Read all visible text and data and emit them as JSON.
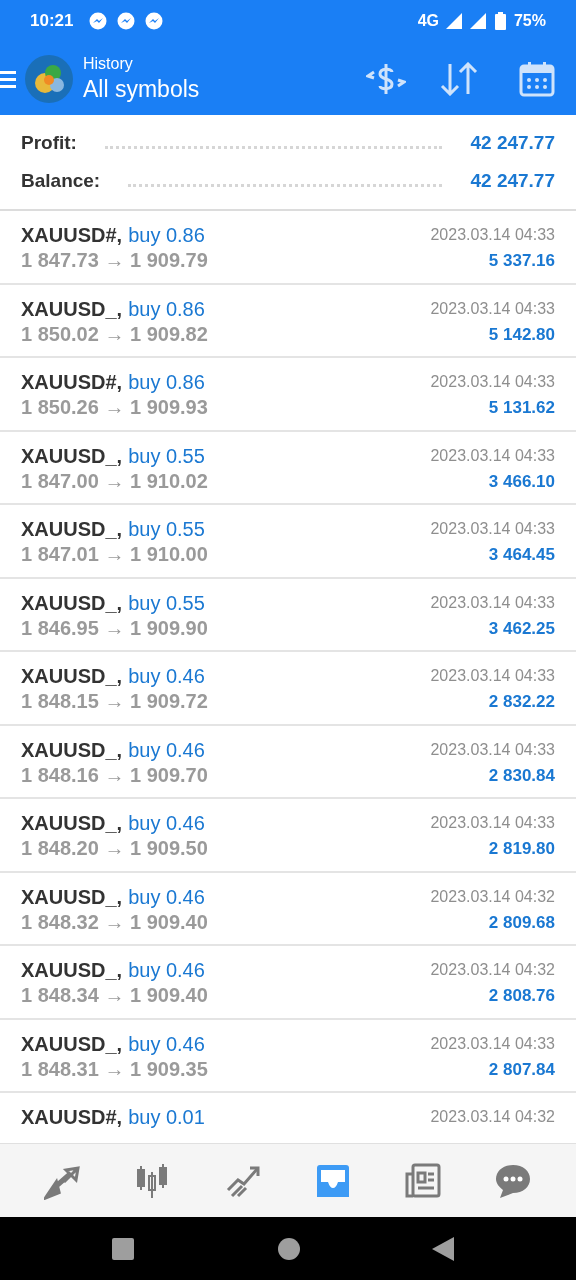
{
  "status_bar": {
    "time": "10:21",
    "network": "4G",
    "battery": "75%"
  },
  "header": {
    "subtitle": "History",
    "title": "All symbols"
  },
  "summary": [
    {
      "label": "Profit:",
      "value": "42 247.77"
    },
    {
      "label": "Balance:",
      "value": "42 247.77"
    }
  ],
  "deals": [
    {
      "symbol": "XAUUSD#,",
      "action": "buy 0.86",
      "prices": "1 847.73 → 1 909.79",
      "time": "2023.03.14 04:33",
      "profit": "5 337.16"
    },
    {
      "symbol": "XAUUSD_,",
      "action": "buy 0.86",
      "prices": "1 850.02 → 1 909.82",
      "time": "2023.03.14 04:33",
      "profit": "5 142.80"
    },
    {
      "symbol": "XAUUSD#,",
      "action": "buy 0.86",
      "prices": "1 850.26 → 1 909.93",
      "time": "2023.03.14 04:33",
      "profit": "5 131.62"
    },
    {
      "symbol": "XAUUSD_,",
      "action": "buy 0.55",
      "prices": "1 847.00 → 1 910.02",
      "time": "2023.03.14 04:33",
      "profit": "3 466.10"
    },
    {
      "symbol": "XAUUSD_,",
      "action": "buy 0.55",
      "prices": "1 847.01 → 1 910.00",
      "time": "2023.03.14 04:33",
      "profit": "3 464.45"
    },
    {
      "symbol": "XAUUSD_,",
      "action": "buy 0.55",
      "prices": "1 846.95 → 1 909.90",
      "time": "2023.03.14 04:33",
      "profit": "3 462.25"
    },
    {
      "symbol": "XAUUSD_,",
      "action": "buy 0.46",
      "prices": "1 848.15 → 1 909.72",
      "time": "2023.03.14 04:33",
      "profit": "2 832.22"
    },
    {
      "symbol": "XAUUSD_,",
      "action": "buy 0.46",
      "prices": "1 848.16 → 1 909.70",
      "time": "2023.03.14 04:33",
      "profit": "2 830.84"
    },
    {
      "symbol": "XAUUSD_,",
      "action": "buy 0.46",
      "prices": "1 848.20 → 1 909.50",
      "time": "2023.03.14 04:33",
      "profit": "2 819.80"
    },
    {
      "symbol": "XAUUSD_,",
      "action": "buy 0.46",
      "prices": "1 848.32 → 1 909.40",
      "time": "2023.03.14 04:32",
      "profit": "2 809.68"
    },
    {
      "symbol": "XAUUSD_,",
      "action": "buy 0.46",
      "prices": "1 848.34 → 1 909.40",
      "time": "2023.03.14 04:32",
      "profit": "2 808.76"
    },
    {
      "symbol": "XAUUSD_,",
      "action": "buy 0.46",
      "prices": "1 848.31 → 1 909.35",
      "time": "2023.03.14 04:33",
      "profit": "2 807.84"
    },
    {
      "symbol": "XAUUSD#,",
      "action": "buy 0.01",
      "time": "2023.03.14 04:32"
    }
  ],
  "bottom_nav": [
    {
      "kind": "quotes",
      "selected": false
    },
    {
      "kind": "chart",
      "selected": false
    },
    {
      "kind": "trade",
      "selected": false
    },
    {
      "kind": "history",
      "selected": true
    },
    {
      "kind": "news",
      "selected": false
    },
    {
      "kind": "chat",
      "selected": false
    }
  ]
}
